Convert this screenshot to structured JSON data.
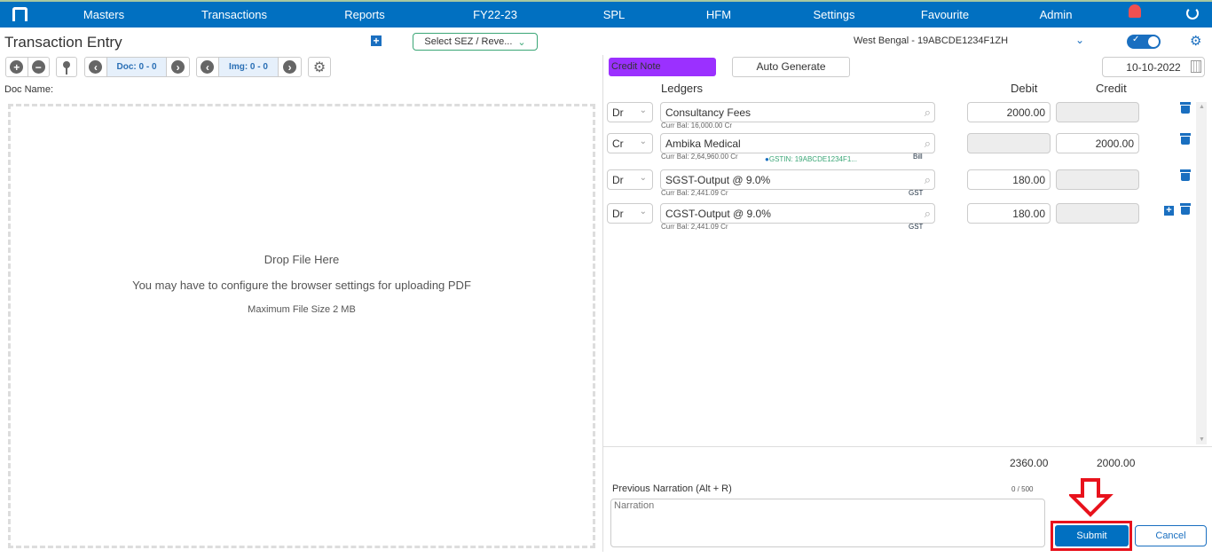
{
  "nav": {
    "items": [
      "Masters",
      "Transactions",
      "Reports",
      "FY22-23",
      "SPL",
      "HFM",
      "Settings",
      "Favourite",
      "Admin"
    ]
  },
  "left": {
    "title": "Transaction Entry",
    "sez_select": "Select SEZ / Reve...",
    "doc_counter": "Doc: 0 - 0",
    "img_counter": "Img: 0 - 0",
    "doc_name_label": "Doc Name:",
    "drop_title": "Drop File Here",
    "drop_hint": "You may have to configure the browser settings for uploading PDF",
    "drop_max": "Maximum File Size 2 MB"
  },
  "right": {
    "gst_select": "West Bengal - 19ABCDE1234F1ZH",
    "voucher_type": "Credit Note",
    "auto_generate": "Auto Generate",
    "date": "10-10-2022",
    "headers": {
      "ledgers": "Ledgers",
      "debit": "Debit",
      "credit": "Credit"
    },
    "rows": [
      {
        "type": "Dr",
        "ledger": "Consultancy Fees",
        "balance": "Curr Bal: 16,000.00 Cr",
        "gstin": "",
        "tag": "",
        "debit": "2000.00",
        "credit": ""
      },
      {
        "type": "Cr",
        "ledger": "Ambika Medical",
        "balance": "Curr Bal: 2,64,960.00 Cr",
        "gstin": "GSTIN: 19ABCDE1234F1...",
        "tag": "Bill",
        "debit": "",
        "credit": "2000.00"
      },
      {
        "type": "Dr",
        "ledger": "SGST-Output @ 9.0%",
        "balance": "Curr Bal: 2,441.09 Cr",
        "gstin": "",
        "tag": "GST",
        "debit": "180.00",
        "credit": ""
      },
      {
        "type": "Dr",
        "ledger": "CGST-Output @ 9.0%",
        "balance": "Curr Bal: 2,441.09 Cr",
        "gstin": "",
        "tag": "GST",
        "debit": "180.00",
        "credit": ""
      }
    ],
    "total_debit": "2360.00",
    "total_credit": "2000.00",
    "narration_label": "Previous Narration (Alt + R)",
    "narration_count": "0 / 500",
    "narration_placeholder": "Narration",
    "submit": "Submit",
    "cancel": "Cancel"
  },
  "colors": {
    "nav": "#0170c1",
    "voucher": "#9b30ff",
    "highlight": "#e8121c"
  }
}
